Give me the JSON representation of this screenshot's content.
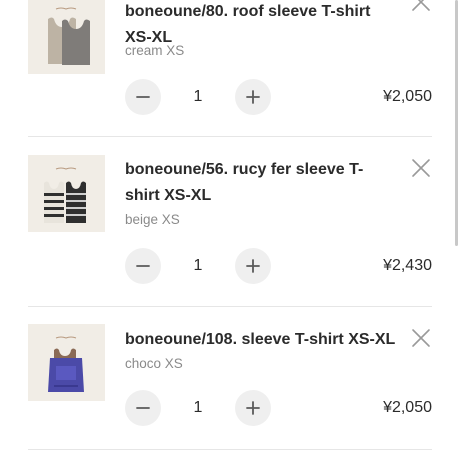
{
  "cart": {
    "items": [
      {
        "title": "boneoune/80. roof sleeve T-shirt XS-XL",
        "variant": "cream XS",
        "quantity": "1",
        "price": "¥2,050",
        "thumb_icon": "tank-top-product-photo"
      },
      {
        "title": "boneoune/56. rucy fer sleeve T-shirt XS-XL",
        "variant": "beige XS",
        "quantity": "1",
        "price": "¥2,430",
        "thumb_icon": "striped-tank-top-product-photo"
      },
      {
        "title": "boneoune/108. sleeve T-shirt XS-XL",
        "variant": "choco XS",
        "quantity": "1",
        "price": "¥2,050",
        "thumb_icon": "purple-tank-top-product-photo"
      }
    ]
  },
  "icons": {
    "remove": "close-icon",
    "decrease": "minus-icon",
    "increase": "plus-icon"
  },
  "colors": {
    "background": "#ffffff",
    "text": "#2b2b2b",
    "muted_text": "#8a8a8a",
    "button_bg": "#efefef",
    "divider": "#e6e6e6",
    "thumb_bg": "#f1ede6"
  }
}
